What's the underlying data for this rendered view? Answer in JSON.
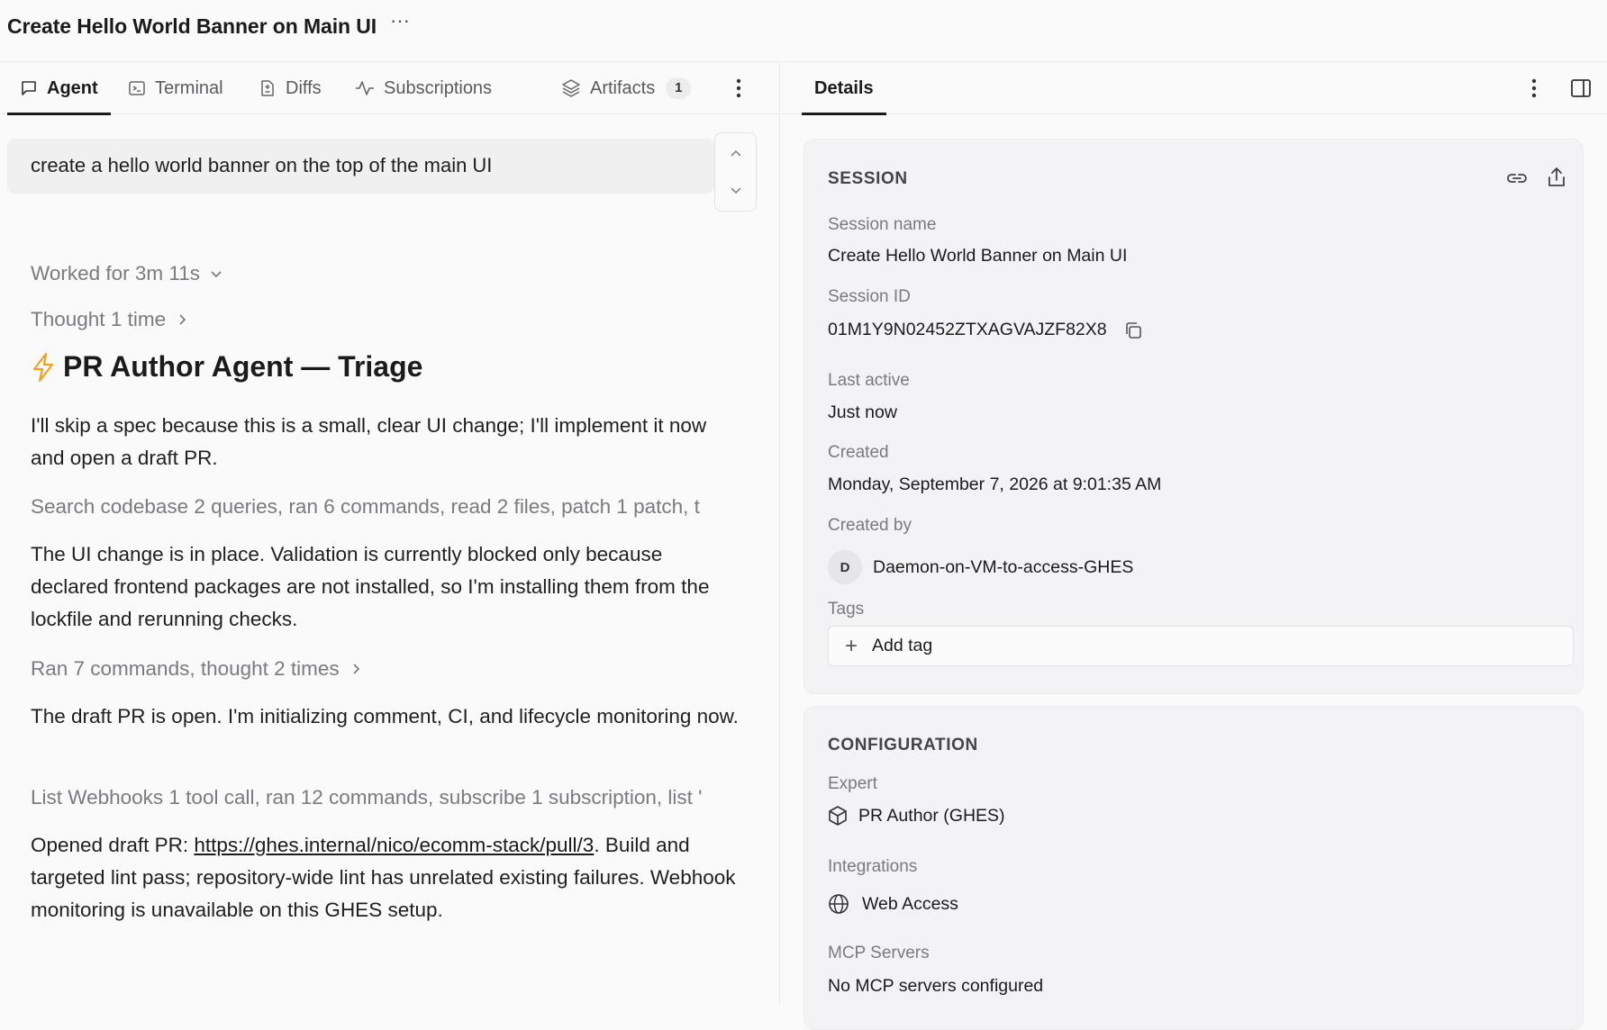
{
  "header": {
    "title": "Create Hello World Banner on Main UI",
    "more_label": "···"
  },
  "tabs": [
    {
      "label": "Agent",
      "icon": "chat-bubble-icon"
    },
    {
      "label": "Terminal",
      "icon": "terminal-icon"
    },
    {
      "label": "Diffs",
      "icon": "diff-icon"
    },
    {
      "label": "Subscriptions",
      "icon": "activity-icon"
    },
    {
      "label": "Artifacts",
      "icon": "layers-icon",
      "count": "1"
    }
  ],
  "prompt": "create a hello world banner on the top of the main UI",
  "conversation": {
    "worked_for": "Worked for 3m 11s",
    "thought": "Thought 1 time",
    "heading": "PR Author Agent — Triage",
    "msg1": "I'll skip a spec because this is a small, clear UI change; I'll implement it now and open a draft PR.",
    "tools1": "Search codebase 2 queries, ran 6 commands, read 2 files, patch 1 patch, t",
    "msg2": "The UI change is in place. Validation is currently blocked only because declared frontend packages are not installed, so I'm installing them from the lockfile and rerunning checks.",
    "tools2": "Ran 7 commands, thought 2 times",
    "msg3": "The draft PR is open. I'm initializing comment, CI, and lifecycle monitoring now.",
    "tools3": "List Webhooks 1 tool call, ran 12 commands, subscribe 1 subscription, list '",
    "msg4_prefix": "Opened draft PR: ",
    "msg4_link": "https://ghes.internal/nico/ecomm-stack/pull/3",
    "msg4_suffix": ". Build and targeted lint pass; repository-wide lint has unrelated existing failures. Webhook monitoring is unavailable on this GHES setup."
  },
  "details": {
    "tab_label": "Details",
    "session": {
      "title": "SESSION",
      "name_label": "Session name",
      "name": "Create Hello World Banner on Main UI",
      "id_label": "Session ID",
      "id": "01M1Y9N02452ZTXAGVAJZF82X8",
      "last_active_label": "Last active",
      "last_active": "Just now",
      "created_label": "Created",
      "created": "Monday, September 7, 2026 at 9:01:35 AM",
      "created_by_label": "Created by",
      "created_by_initial": "D",
      "created_by": "Daemon-on-VM-to-access-GHES",
      "tags_label": "Tags",
      "add_tag": "Add tag"
    },
    "configuration": {
      "title": "CONFIGURATION",
      "expert_label": "Expert",
      "expert": "PR Author (GHES)",
      "integrations_label": "Integrations",
      "integration": "Web Access",
      "mcp_label": "MCP Servers",
      "mcp": "No MCP servers configured"
    }
  }
}
